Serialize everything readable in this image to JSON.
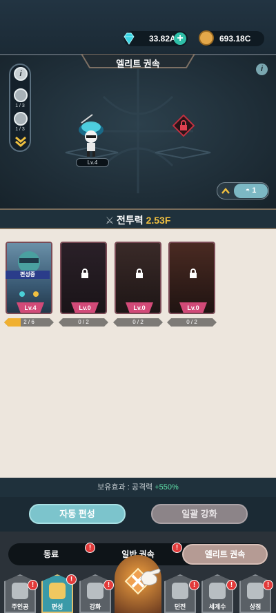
{
  "currency": {
    "gems": "33.82A",
    "gold": "693.18C"
  },
  "scene": {
    "title": "엘리트 권속",
    "side_counts": [
      "1 / 3",
      "1 / 3"
    ],
    "character_level": "Lv.4",
    "party_count": "1"
  },
  "power": {
    "label": "전투력",
    "value": "2.53F"
  },
  "cards": [
    {
      "level": "Lv.4",
      "progress": "2 / 6",
      "progress_fraction": 0.33,
      "status": "편성중",
      "locked": false
    },
    {
      "level": "Lv.0",
      "progress": "0 / 2",
      "progress_fraction": 0,
      "status": "",
      "locked": true
    },
    {
      "level": "Lv.0",
      "progress": "0 / 2",
      "progress_fraction": 0,
      "status": "",
      "locked": true
    },
    {
      "level": "Lv.0",
      "progress": "0 / 2",
      "progress_fraction": 0,
      "status": "",
      "locked": true
    }
  ],
  "effect": {
    "label": "보유효과 : 공격력",
    "value": "+550%"
  },
  "buttons": {
    "auto": "자동 편성",
    "bulk": "일괄 강화"
  },
  "tabs": [
    {
      "label": "동료",
      "badge": "!"
    },
    {
      "label": "일반 권속",
      "badge": "!"
    },
    {
      "label": "엘리트 권속",
      "badge": ""
    }
  ],
  "nav": [
    {
      "label": "주인공",
      "icon": "hero-icon",
      "badge": "!"
    },
    {
      "label": "편성",
      "icon": "formation-icon",
      "badge": "!"
    },
    {
      "label": "강화",
      "icon": "upgrade-icon",
      "badge": "!"
    },
    {
      "label": "",
      "icon": "battle-icon",
      "badge": ""
    },
    {
      "label": "던전",
      "icon": "dungeon-icon",
      "badge": "!"
    },
    {
      "label": "세계수",
      "icon": "world-tree-icon",
      "badge": "!"
    },
    {
      "label": "상점",
      "icon": "shop-icon",
      "badge": "!"
    }
  ],
  "colors": {
    "accent_teal": "#7cc4cc",
    "power_gold": "#f0c040",
    "badge_red": "#e23a3a",
    "card_pink": "#d24a78"
  }
}
